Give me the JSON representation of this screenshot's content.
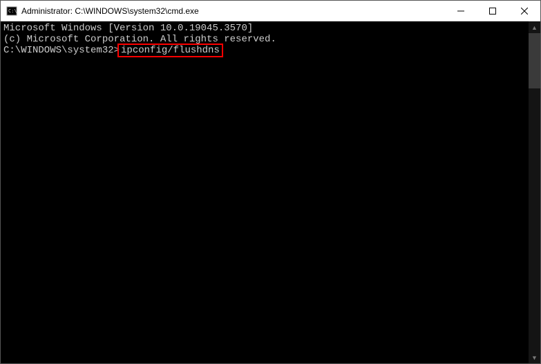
{
  "window": {
    "title": "Administrator: C:\\WINDOWS\\system32\\cmd.exe"
  },
  "terminal": {
    "line1": "Microsoft Windows [Version 10.0.19045.3570]",
    "line2": "(c) Microsoft Corporation. All rights reserved.",
    "blank": "",
    "prompt": "C:\\WINDOWS\\system32>",
    "command": "ipconfig/flushdns"
  }
}
